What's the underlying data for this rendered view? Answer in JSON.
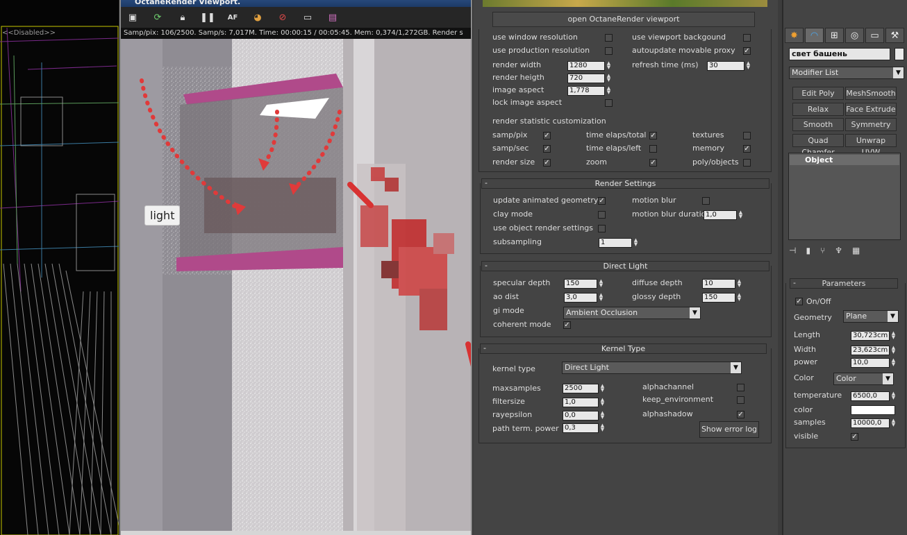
{
  "left_viewport": {
    "disabled_label": "<<Disabled>>"
  },
  "octane": {
    "title": "OctaneRender Viewport.",
    "toolbar_icons": [
      "layout-icon",
      "refresh-icon",
      "lock-icon",
      "pause-icon",
      "af-icon",
      "color-icon",
      "no-icon",
      "monitor-icon",
      "picture-icon"
    ],
    "status": "Samp/pix: 106/2500.   Samp/s: 7,017M.   Time: 00:00:15 / 00:05:45.   Mem: 0,374/1,272GB.   Render s",
    "overlay_label": "light"
  },
  "settings": {
    "open_button": "open OctaneRender viewport",
    "viewport": {
      "use_window_resolution": "use window resolution",
      "use_viewport_background": "use viewport backgound",
      "use_production_resolution": "use production resolution",
      "autoupdate_movable_proxy": "autoupdate movable proxy",
      "render_width_label": "render width",
      "render_width": "1280",
      "refresh_time_label": "refresh time (ms)",
      "refresh_time": "30",
      "render_height_label": "render heigth",
      "render_height": "720",
      "image_aspect_label": "image aspect",
      "image_aspect": "1,778",
      "lock_image_aspect": "lock image aspect",
      "stat_heading": "render statistic customization",
      "samp_pix": "samp/pix",
      "time_elaps_total": "time elaps/total",
      "textures": "textures",
      "samp_sec": "samp/sec",
      "time_elaps_left": "time elaps/left",
      "memory": "memory",
      "render_size": "render size",
      "zoom": "zoom",
      "poly_objects": "poly/objects"
    },
    "render_settings": {
      "heading": "Render Settings",
      "update_animated_geometry": "update animated geometry",
      "motion_blur": "motion blur",
      "clay_mode": "clay mode",
      "motion_blur_duration_label": "motion blur duration",
      "motion_blur_duration": "1,0",
      "use_object_render_settings": "use object render settings",
      "subsampling_label": "subsampling",
      "subsampling": "1"
    },
    "direct_light": {
      "heading": "Direct Light",
      "specular_depth_label": "specular depth",
      "specular_depth": "150",
      "diffuse_depth_label": "diffuse depth",
      "diffuse_depth": "10",
      "ao_dist_label": "ao dist",
      "ao_dist": "3,0",
      "glossy_depth_label": "glossy depth",
      "glossy_depth": "150",
      "gi_mode_label": "gi mode",
      "gi_mode": "Ambient Occlusion",
      "coherent_mode": "coherent mode"
    },
    "kernel": {
      "heading": "Kernel Type",
      "kernel_type_label": "kernel type",
      "kernel_type": "Direct Light",
      "maxsamples_label": "maxsamples",
      "maxsamples": "2500",
      "alphachannel": "alphachannel",
      "filtersize_label": "filtersize",
      "filtersize": "1,0",
      "keep_environment": "keep_environment",
      "rayepsilon_label": "rayepsilon",
      "rayepsilon": "0,0",
      "alphashadow": "alphashadow",
      "path_term_power_label": "path term. power",
      "path_term_power": "0,3",
      "show_error_log": "Show error log"
    }
  },
  "command_panel": {
    "tabs": [
      "create-icon",
      "modify-icon",
      "hierarchy-icon",
      "motion-icon",
      "display-icon",
      "utilities-icon"
    ],
    "object_name": "свет башень",
    "modifier_list": "Modifier List",
    "modifiers": [
      "Edit Poly",
      "MeshSmooth",
      "Relax",
      "Face Extrude",
      "Smooth",
      "Symmetry",
      "Quad Chamfer",
      "Unwrap UVW"
    ],
    "stack_item": "Object",
    "parameters": {
      "heading": "Parameters",
      "on_off": "On/Off",
      "geometry_label": "Geometry",
      "geometry": "Plane",
      "length_label": "Length",
      "length": "30,723cm",
      "width_label": "Width",
      "width": "23,623cm",
      "power_label": "power",
      "power": "10,0",
      "color_label": "Color",
      "color_mode": "Color",
      "temperature_label": "temperature",
      "temperature": "6500,0",
      "color2_label": "color",
      "samples_label": "samples",
      "samples": "10000,0",
      "visible_label": "visible"
    }
  }
}
